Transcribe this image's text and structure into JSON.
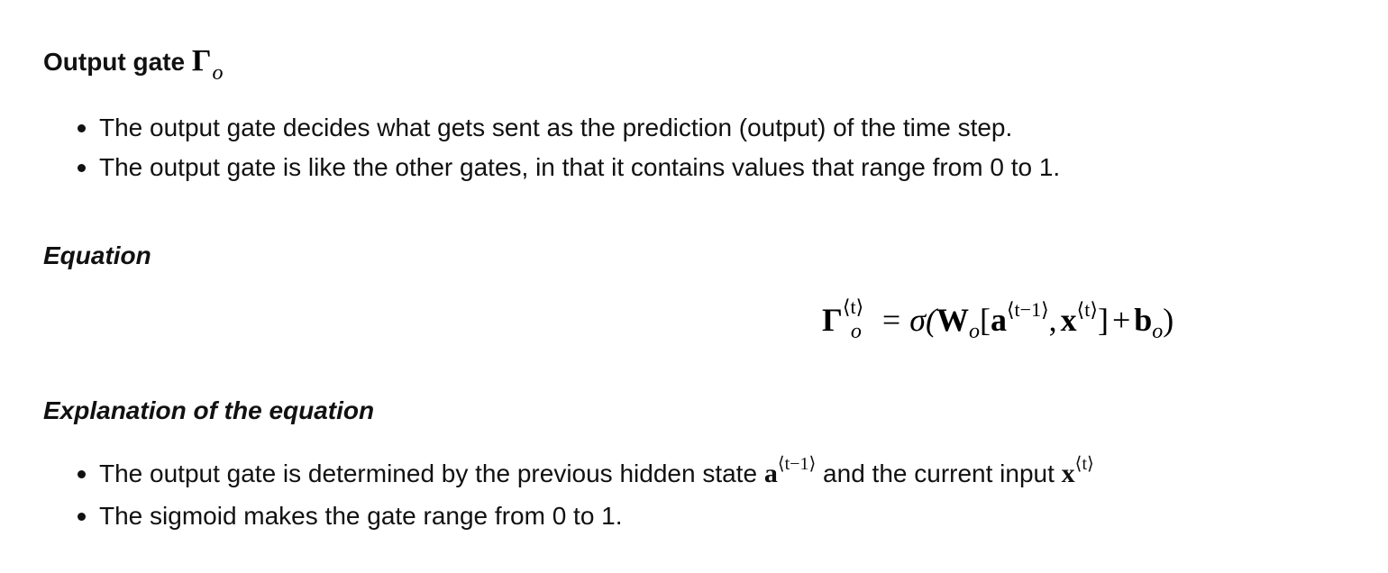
{
  "section": {
    "title_text": "Output gate ",
    "gate_symbol": "Γ",
    "gate_subscript": "o"
  },
  "description_bullets": [
    "The output gate decides what gets sent as the prediction (output) of the time step.",
    "The output gate is like the other gates, in that it contains values that range from 0 to 1."
  ],
  "equation_section": {
    "heading": "Equation",
    "equation": {
      "lhs_symbol": "Γ",
      "lhs_superscript": "⟨t⟩",
      "lhs_subscript": "o",
      "equals": "=",
      "sigma": "σ(",
      "weight": "W",
      "weight_subscript": "o",
      "open_bracket": "[",
      "a_symbol": "a",
      "a_superscript": "⟨t−1⟩",
      "comma": ",",
      "x_symbol": "x",
      "x_superscript": "⟨t⟩",
      "close_bracket": "]",
      "plus": "+",
      "bias": "b",
      "bias_subscript": "o",
      "close_paren": ")"
    }
  },
  "explanation_section": {
    "heading": "Explanation of the equation",
    "bullet1": {
      "text_before": "The output gate is determined by the previous hidden state ",
      "a_symbol": "a",
      "a_superscript": "⟨t−1⟩",
      "text_middle": " and the current input ",
      "x_symbol": "x",
      "x_superscript": "⟨t⟩"
    },
    "bullet2": "The sigmoid makes the gate range from 0 to 1."
  }
}
